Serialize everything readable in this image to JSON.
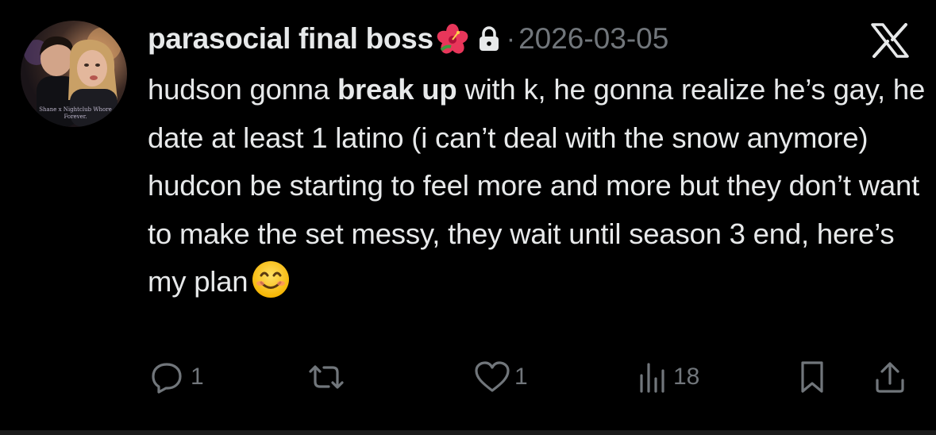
{
  "tweet": {
    "display_name": "parasocial final boss",
    "name_emoji": "hibiscus-emoji",
    "protected_icon": "lock-icon",
    "separator": "·",
    "date": "2026-03-05",
    "platform_icon": "x-logo-icon",
    "avatar_caption_line1": "Shane x Nightclub Whore",
    "avatar_caption_line2": "Forever.",
    "text_part1": "hudson gonna ",
    "text_bold": "break up",
    "text_part2": " with k, he gonna realize he’s gay, he date at least 1 latino (i can’t deal with the snow anymore) hudcon be starting to feel more and more but they don’t want to make the set messy, they wait until season 3 end, here’s my plan",
    "text_emoji": "smiling-face-emoji"
  },
  "actions": {
    "reply_icon": "reply-icon",
    "reply_count": "1",
    "retweet_icon": "retweet-icon",
    "like_icon": "heart-icon",
    "like_count": "1",
    "views_icon": "views-icon",
    "views_count": "18",
    "bookmark_icon": "bookmark-icon",
    "share_icon": "share-icon"
  },
  "colors": {
    "background": "#000000",
    "primary_text": "#e7e9ea",
    "secondary_text": "#71767b"
  }
}
